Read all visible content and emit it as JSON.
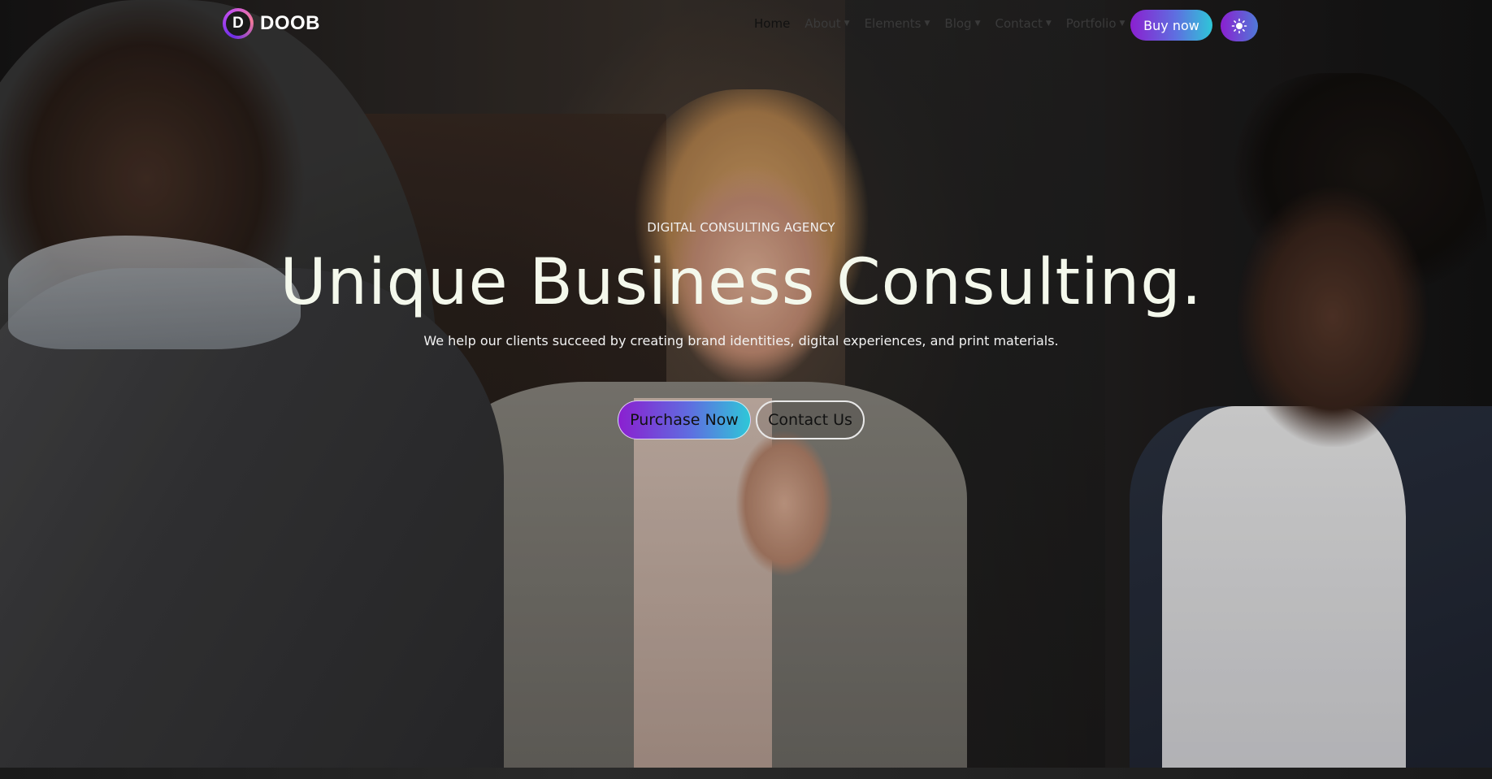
{
  "brand": {
    "logo_letter": "D",
    "name": "DOOB"
  },
  "nav": {
    "items": [
      {
        "label": "Home",
        "dropdown": false,
        "active": true
      },
      {
        "label": "About",
        "dropdown": true
      },
      {
        "label": "Elements",
        "dropdown": true
      },
      {
        "label": "Blog",
        "dropdown": true
      },
      {
        "label": "Contact",
        "dropdown": true
      },
      {
        "label": "Portfolio",
        "dropdown": true
      }
    ],
    "buy_label": "Buy now",
    "theme_toggle_icon": "sun-icon"
  },
  "hero": {
    "kicker": "DIGITAL CONSULTING AGENCY",
    "title": "Unique Business Consulting.",
    "subtitle": "We help our clients succeed by creating brand identities, digital experiences, and print materials.",
    "primary_cta": "Purchase Now",
    "secondary_cta": "Contact Us"
  },
  "colors": {
    "gradient_start": "#8b1fd0",
    "gradient_mid": "#5e6fe0",
    "gradient_end": "#2ec7d8",
    "headline": "#f4f8ec"
  }
}
